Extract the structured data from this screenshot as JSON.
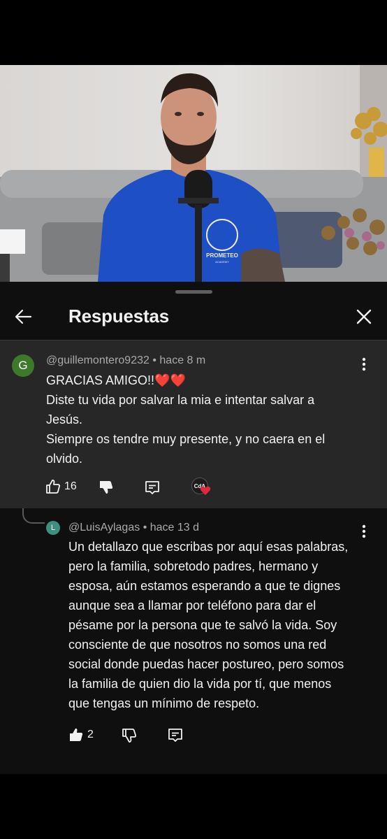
{
  "sheet": {
    "title": "Respuestas"
  },
  "parent_comment": {
    "avatar_letter": "G",
    "avatar_color": "#3c7a2a",
    "author": "@guillemontero9232",
    "time": "hace 8 m",
    "lines": [
      "GRACIAS AMIGO!!❤️❤️",
      "Diste tu vida por salvar la mia e intentar salvar a",
      "Jesús.",
      "Siempre os tendre muy presente, y no caera en el",
      "olvido."
    ],
    "likes": "16",
    "creator_badge": "CdA"
  },
  "reply": {
    "avatar_letter": "L",
    "avatar_color": "#3f8f7f",
    "author": "@LuisAylagas",
    "time": "hace 13 d",
    "lines": [
      "Un detallazo que escribas por aquí esas palabras,",
      "pero la familia, sobretodo padres, hermano y",
      "esposa, aún estamos esperando a que te dignes",
      "aunque sea a llamar por teléfono para dar el",
      "pésame por la persona que te salvó la vida. Soy",
      "consciente de que nosotros no somos una red",
      "social donde puedas hacer postureo, pero somos",
      "la familia de quien dio la vida por tí, que menos",
      "que tengas un mínimo de respeto."
    ],
    "likes": "2"
  },
  "video": {
    "shirt_text": "PROMETEO",
    "shirt_subtext": "ACADEMY"
  },
  "colors": {
    "sheet_bg": "#0f0f0f",
    "highlight_bg": "#272727",
    "text": "#f1f1f1",
    "meta": "#aaaaaa"
  }
}
